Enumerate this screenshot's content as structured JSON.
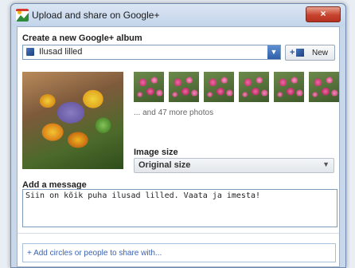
{
  "window": {
    "title": "Upload and share on Google+",
    "close_glyph": "×"
  },
  "album": {
    "label": "Create a new Google+ album",
    "selected": "Ilusad lilled",
    "new_button_plus": "+",
    "new_button_label": "New"
  },
  "photos": {
    "more_text": "... and 47 more photos"
  },
  "image_size": {
    "label": "Image size",
    "selected": "Original size"
  },
  "message": {
    "label": "Add a message",
    "text": "Siin on kõik puha ilusad lilled. Vaata ja imesta!"
  },
  "share": {
    "placeholder": "+ Add circles or people to share with..."
  },
  "icons": {
    "dropdown": "▼"
  }
}
